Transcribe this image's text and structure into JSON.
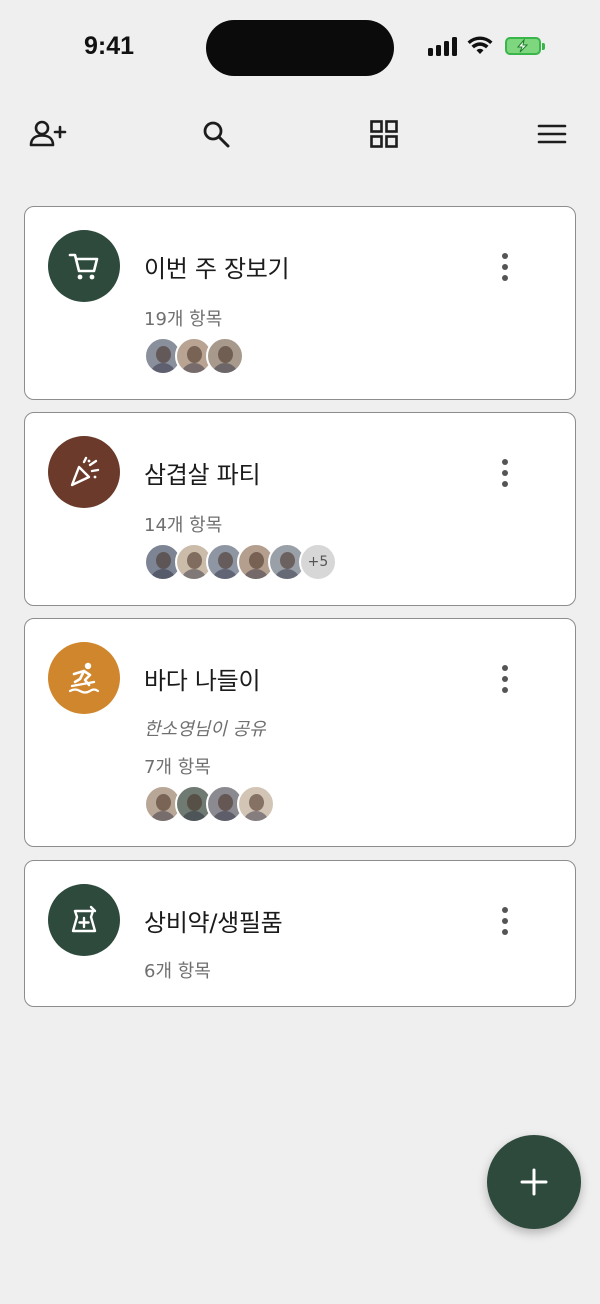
{
  "status_bar": {
    "time": "9:41"
  },
  "toolbar": {
    "icons": [
      "add-person-icon",
      "search-icon",
      "grid-icon",
      "menu-icon"
    ]
  },
  "lists": [
    {
      "title": "이번 주 장보기",
      "count": "19개 항목",
      "shared_by": "",
      "icon": "cart-icon",
      "color": "#2d4a3c",
      "members": 3,
      "extra": ""
    },
    {
      "title": "삼겹살 파티",
      "count": "14개 항목",
      "shared_by": "",
      "icon": "party-popper-icon",
      "color": "#6b3a2a",
      "members": 5,
      "extra": "+5"
    },
    {
      "title": "바다 나들이",
      "count": "7개 항목",
      "shared_by": "한소영님이 공유",
      "icon": "surfing-icon",
      "color": "#d0862c",
      "members": 4,
      "extra": ""
    },
    {
      "title": "상비약/생필품",
      "count": "6개 항목",
      "shared_by": "",
      "icon": "medicine-icon",
      "color": "#2d4a3c",
      "members": 0,
      "extra": ""
    }
  ],
  "fab": {
    "icon": "plus-icon"
  }
}
